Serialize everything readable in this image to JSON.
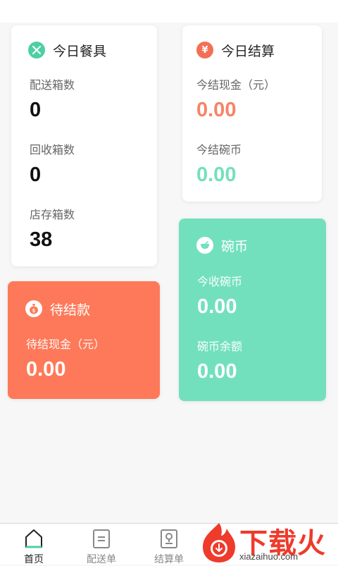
{
  "colors": {
    "accent_teal": "#73e0bd",
    "accent_orange": "#fe7959",
    "value_orange": "#f68466",
    "value_teal": "#73e0bd"
  },
  "tableware": {
    "title": "今日餐具",
    "icon": "fork-knife-icon",
    "delivered_label": "配送箱数",
    "delivered_value": "0",
    "recycled_label": "回收箱数",
    "recycled_value": "0",
    "stock_label": "店存箱数",
    "stock_value": "38"
  },
  "settlement": {
    "title": "今日结算",
    "icon": "yen-icon",
    "cash_label": "今结现金（元）",
    "cash_value": "0.00",
    "coin_label": "今结碗币",
    "coin_value": "0.00"
  },
  "pending": {
    "title": "待结款",
    "icon": "money-bag-icon",
    "cash_label": "待结现金（元）",
    "cash_value": "0.00"
  },
  "bowl_coin": {
    "title": "碗币",
    "icon": "bowl-icon",
    "received_label": "今收碗币",
    "received_value": "0.00",
    "balance_label": "碗币余额",
    "balance_value": "0.00"
  },
  "nav": {
    "items": [
      {
        "label": "首页",
        "icon": "home-icon"
      },
      {
        "label": "配送单",
        "icon": "list-document-icon"
      },
      {
        "label": "结算单",
        "icon": "settlement-document-icon"
      }
    ]
  },
  "watermark": {
    "logo_text": "下载火",
    "url": "xiazaihuo.com",
    "icon": "flame-logo-icon"
  }
}
